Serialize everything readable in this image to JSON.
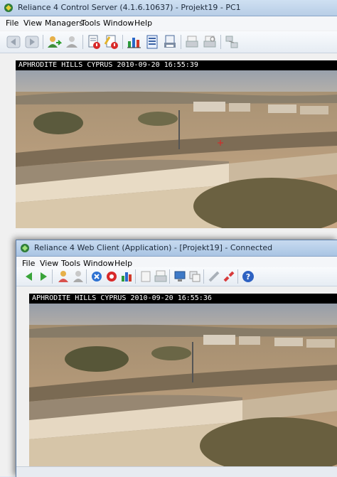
{
  "control_server": {
    "title": "Reliance 4 Control Server (4.1.6.10637) - Projekt19 - PC1",
    "menu": [
      "File",
      "View",
      "Managers",
      "Tools",
      "Window",
      "Help"
    ],
    "toolbar_icons": [
      "back-icon",
      "forward-icon",
      "user-login-icon",
      "user-logout-icon",
      "alarm-book-icon",
      "alarm-ack-icon",
      "chart-icon",
      "report-icon",
      "print-report-icon",
      "print-icon",
      "print-preview-icon",
      "network-icon"
    ],
    "camera_caption": "APHRODITE HILLS CYPRUS 2010-09-20 16:55:39"
  },
  "web_client": {
    "title": "Reliance 4 Web Client (Application) - [Projekt19] - Connected",
    "menu": [
      "File",
      "View",
      "Tools",
      "Window",
      "Help"
    ],
    "toolbar_icons": [
      "back-icon",
      "forward-icon",
      "user-login-icon",
      "user-logout-icon",
      "alarm-stop-icon",
      "alarm-list-icon",
      "chart-icon",
      "blank-icon",
      "print-icon",
      "computer-icon",
      "copy-icon",
      "connect-icon",
      "disconnect-icon",
      "help-icon"
    ],
    "camera_caption": "APHRODITE HILLS CYPRUS 2010-09-20 16:55:36"
  },
  "colors": {
    "title_text": "#1e2a3a",
    "caption_bg": "#000000",
    "caption_text": "#ffffff",
    "sky": "#9aa7b8",
    "ground": "#b79c78"
  }
}
